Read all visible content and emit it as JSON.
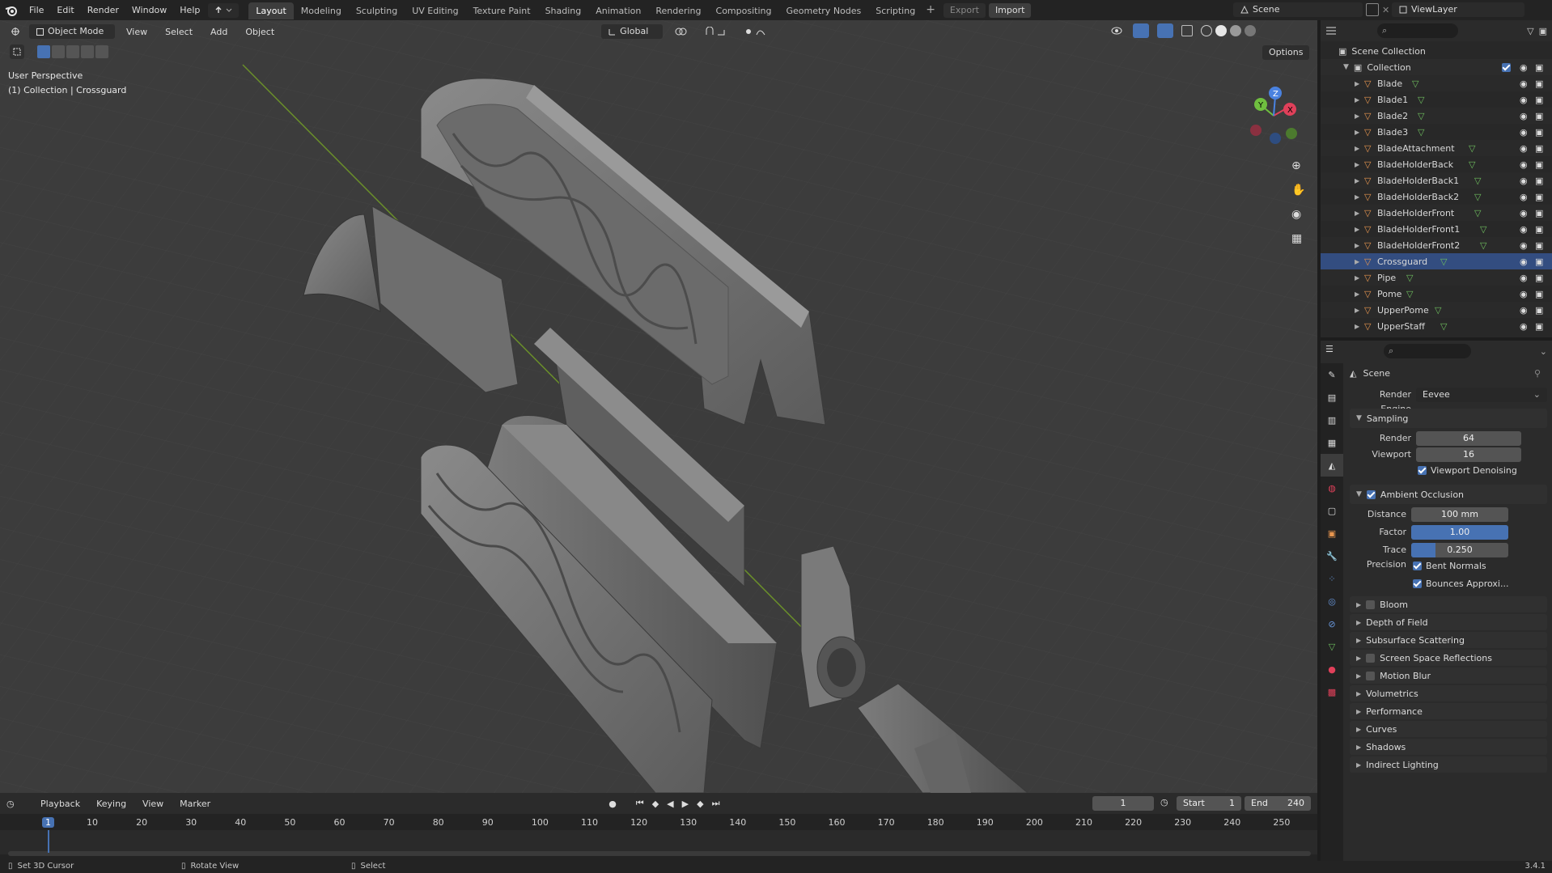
{
  "topbar": {
    "menus": [
      "File",
      "Edit",
      "Render",
      "Window",
      "Help"
    ],
    "workspaces": [
      "Layout",
      "Modeling",
      "Sculpting",
      "UV Editing",
      "Texture Paint",
      "Shading",
      "Animation",
      "Rendering",
      "Compositing",
      "Geometry Nodes",
      "Scripting"
    ],
    "active_workspace": "Layout",
    "export_label": "Export",
    "import_label": "Import",
    "scene_name": "Scene",
    "view_layer": "ViewLayer"
  },
  "viewport_header": {
    "mode": "Object Mode",
    "menus": [
      "View",
      "Select",
      "Add",
      "Object"
    ],
    "transform_orientation": "Global",
    "options_label": "Options"
  },
  "viewport": {
    "perspective_label": "User Perspective",
    "collection_label": "(1) Collection | Crossguard",
    "gizmo_axes": [
      "X",
      "Y",
      "Z"
    ]
  },
  "outliner": {
    "root": "Scene Collection",
    "collection": "Collection",
    "items": [
      "Blade",
      "Blade1",
      "Blade2",
      "Blade3",
      "BladeAttachment",
      "BladeHolderBack",
      "BladeHolderBack1",
      "BladeHolderBack2",
      "BladeHolderFront",
      "BladeHolderFront1",
      "BladeHolderFront2",
      "Crossguard",
      "Pipe",
      "Pome",
      "UpperPome",
      "UpperStaff"
    ],
    "selected": "Crossguard"
  },
  "properties": {
    "context": "Scene",
    "render_engine_label": "Render Engine",
    "render_engine": "Eevee",
    "sampling": {
      "title": "Sampling",
      "render_label": "Render",
      "render_value": "64",
      "viewport_label": "Viewport",
      "viewport_value": "16",
      "denoise_label": "Viewport Denoising"
    },
    "ao": {
      "title": "Ambient Occlusion",
      "distance_label": "Distance",
      "distance_value": "100 mm",
      "factor_label": "Factor",
      "factor_value": "1.00",
      "factor_fill": 1.0,
      "trace_label": "Trace Precision",
      "trace_value": "0.250",
      "trace_fill": 0.25,
      "bent_label": "Bent Normals",
      "bounces_label": "Bounces Approxi..."
    },
    "panels": [
      {
        "label": "Bloom",
        "checkbox": true
      },
      {
        "label": "Depth of Field",
        "checkbox": false
      },
      {
        "label": "Subsurface Scattering",
        "checkbox": false
      },
      {
        "label": "Screen Space Reflections",
        "checkbox": true
      },
      {
        "label": "Motion Blur",
        "checkbox": true
      },
      {
        "label": "Volumetrics",
        "checkbox": false
      },
      {
        "label": "Performance",
        "checkbox": false
      },
      {
        "label": "Curves",
        "checkbox": false
      },
      {
        "label": "Shadows",
        "checkbox": false
      },
      {
        "label": "Indirect Lighting",
        "checkbox": false
      }
    ]
  },
  "timeline": {
    "menus": [
      "Playback",
      "Keying",
      "View",
      "Marker"
    ],
    "current_frame": "1",
    "start_label": "Start",
    "start_value": "1",
    "end_label": "End",
    "end_value": "240",
    "ruler": [
      "1",
      "10",
      "20",
      "30",
      "40",
      "50",
      "60",
      "70",
      "80",
      "90",
      "100",
      "110",
      "120",
      "130",
      "140",
      "150",
      "160",
      "170",
      "180",
      "190",
      "200",
      "210",
      "220",
      "230",
      "240",
      "250"
    ]
  },
  "statusbar": {
    "hint1": "Set 3D Cursor",
    "hint2": "Rotate View",
    "hint3": "Select",
    "version": "3.4.1"
  },
  "colors": {
    "accent": "#4772b3",
    "selected_row": "#334d80",
    "object_icon": "#e8964f",
    "mesh_icon": "#6fbf5f"
  }
}
